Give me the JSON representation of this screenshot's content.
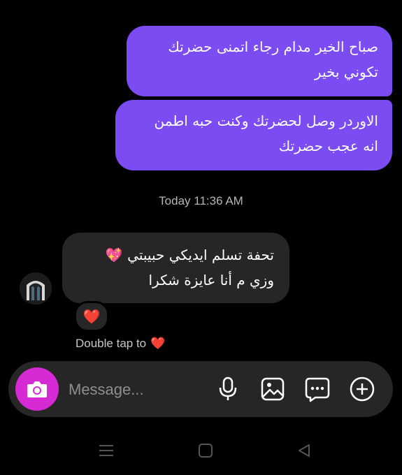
{
  "messages": {
    "outgoing": [
      {
        "line1": "صباح الخير مدام رجاء اتمنى حضرتك",
        "line2": "تكوني بخير"
      },
      {
        "line1": "الاوردر وصل لحضرتك وكنت حبه اطمن",
        "line2": "انه عجب حضرتك"
      }
    ],
    "timestamp": "Today 11:36 AM",
    "incoming": {
      "line1": "تحفة تسلم ايديكي حبيبتي 💖",
      "line2": "وزي م أنا عايزة شكرا"
    },
    "reaction": "❤️",
    "double_tap_text": "Double tap to",
    "double_tap_emoji": "❤️"
  },
  "composer": {
    "placeholder": "Message...",
    "camera_icon": "camera-icon",
    "tools": [
      "microphone-icon",
      "image-icon",
      "sticker-chat-icon",
      "add-icon"
    ]
  },
  "colors": {
    "outgoing_bubble": "#7a4cf2",
    "incoming_bubble": "#262626",
    "camera_button": "#d62ad4"
  },
  "navigation": [
    "menu-icon",
    "home-icon",
    "back-icon"
  ]
}
